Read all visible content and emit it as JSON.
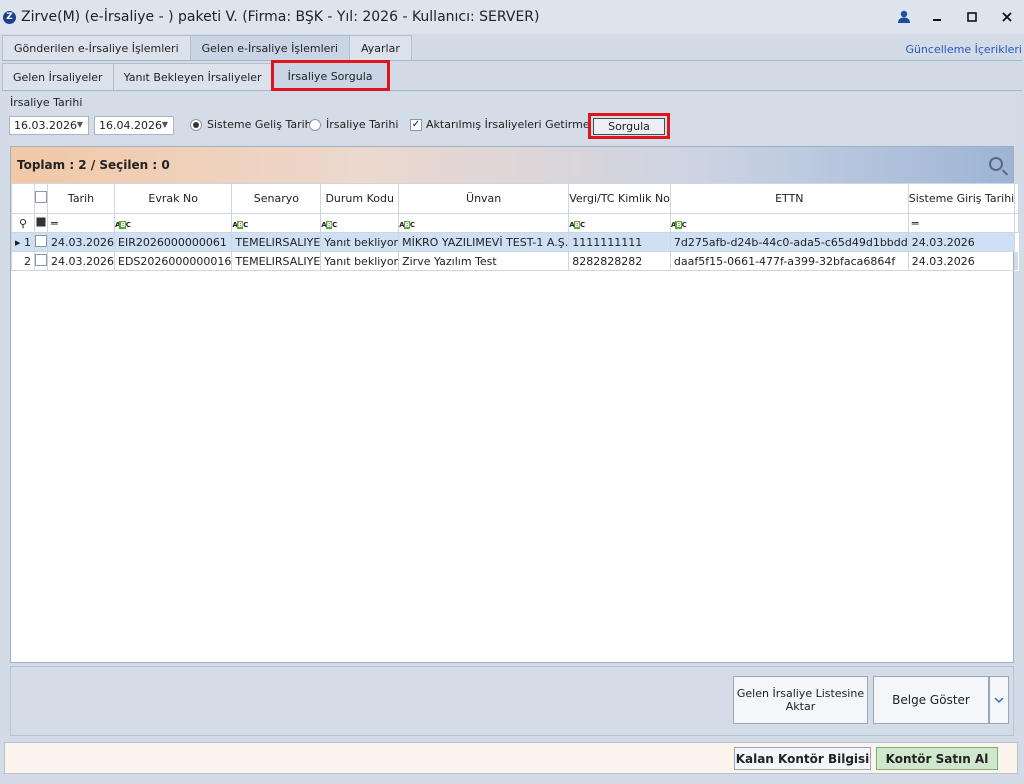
{
  "window": {
    "title": "Zirve(M)  (e-İrsaliye - ) paketi V. (Firma: BŞK - Yıl: 2026 - Kullanıcı: SERVER)"
  },
  "main_tabs": [
    {
      "label": "Gönderilen e-İrsaliye İşlemleri"
    },
    {
      "label": "Gelen e-İrsaliye İşlemleri"
    },
    {
      "label": "Ayarlar"
    }
  ],
  "updates_link": "Güncelleme İçerikleri",
  "sub_tabs": [
    {
      "label": "Gelen İrsaliyeler"
    },
    {
      "label": "Yanıt Bekleyen İrsaliyeler"
    },
    {
      "label": "İrsaliye Sorgula"
    }
  ],
  "filter": {
    "label": "İrsaliye Tarihi",
    "date_start": "16.03.2026",
    "date_end": "16.04.2026",
    "radio_system": "Sisteme Geliş Tarihi",
    "radio_irsaliye": "İrsaliye Tarihi",
    "checkbox_label": "Aktarılmış İrsaliyeleri Getirme",
    "query_button": "Sorgula"
  },
  "grid": {
    "summary": "Toplam : 2 / Seçilen : 0",
    "columns": [
      "Tarih",
      "Evrak No",
      "Senaryo",
      "Durum Kodu",
      "Ünvan",
      "Vergi/TC Kimlik No",
      "ETTN",
      "Sisteme Giriş Tarihi"
    ],
    "rows": [
      {
        "num": "1",
        "tarih": "24.03.2026",
        "evrak": "EIR2026000000061",
        "senaryo": "TEMELIRSALIYE",
        "durum": "Yanıt bekliyor",
        "unvan": "MİKRO YAZILIMEVİ TEST-1 A.Ş.",
        "vergi": "1111111111",
        "ettn": "7d275afb-d24b-44c0-ada5-c65d49d1bbdd",
        "giris": "24.03.2026"
      },
      {
        "num": "2",
        "tarih": "24.03.2026",
        "evrak": "EDS2026000000016",
        "senaryo": "TEMELIRSALIYE",
        "durum": "Yanıt bekliyor",
        "unvan": "Zirve Yazılım Test",
        "vergi": "8282828282",
        "ettn": "daaf5f15-0661-477f-a399-32bfaca6864f",
        "giris": "24.03.2026"
      }
    ]
  },
  "actions": {
    "transfer_line1": "Gelen İrsaliye Listesine",
    "transfer_line2": "Aktar",
    "show_doc": "Belge Göster"
  },
  "status": {
    "credit_info": "Kalan Kontör Bilgisi",
    "buy_credit": "Kontör Satın Al"
  },
  "colors": {
    "highlight": "#e0151c",
    "selected_row": "#cfe0f4",
    "buy_button": "#cfe7cc"
  }
}
